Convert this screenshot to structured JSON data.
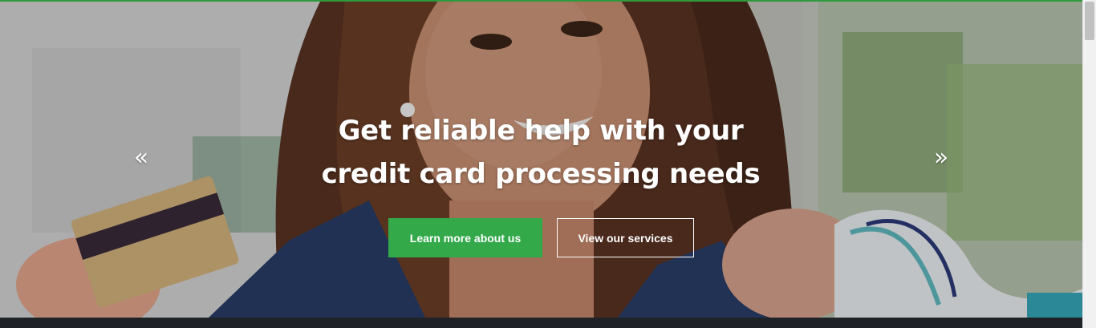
{
  "hero": {
    "headline_line1": "Get reliable help with your",
    "headline_line2": "credit card processing needs",
    "primary_button": "Learn more about us",
    "secondary_button": "View our services",
    "prev_arrow": "«",
    "next_arrow": "»"
  },
  "colors": {
    "accent_green": "#33a94a",
    "top_line": "#2e9a3c",
    "footer": "#1f2226"
  },
  "icons": {
    "prev": "double-chevron-left-icon",
    "next": "double-chevron-right-icon"
  }
}
